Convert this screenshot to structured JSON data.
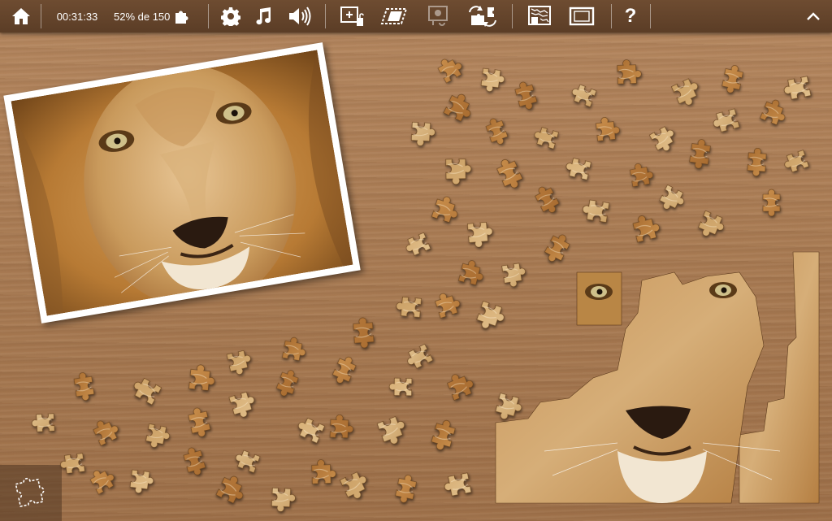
{
  "toolbar": {
    "home": {
      "icon": "home-icon"
    },
    "timer": "00:31:33",
    "progress": "52% de 150",
    "progress_icon": "puzzle-piece-icon",
    "settings": {
      "icon": "gear-icon"
    },
    "music": {
      "icon": "music-note-icon"
    },
    "sound": {
      "icon": "speaker-icon"
    },
    "edges": {
      "icon": "edge-pieces-icon"
    },
    "scatter": {
      "icon": "scatter-pieces-icon"
    },
    "preview": {
      "icon": "preview-image-icon",
      "enabled": false
    },
    "shuffle": {
      "icon": "shuffle-pieces-icon"
    },
    "background": {
      "icon": "background-pattern-icon"
    },
    "frame": {
      "icon": "frame-icon"
    },
    "help": {
      "icon": "help-icon",
      "label": "?"
    },
    "collapse": {
      "icon": "chevron-up-icon"
    }
  },
  "board": {
    "completion_percent": 52,
    "total_pieces": 150,
    "reference_image": "lion-face-photo",
    "piece_tray_icon": "puzzle-outline-icon"
  },
  "colors": {
    "toolbar_bg": "#5f4029",
    "table_wood": "#a97b53",
    "accent_white": "#ffffff"
  }
}
